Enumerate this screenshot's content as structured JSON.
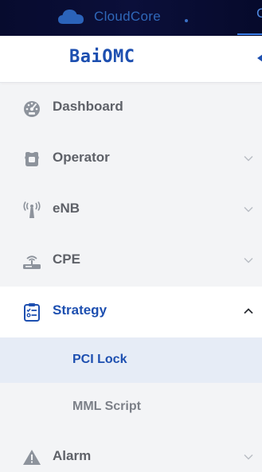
{
  "topbar": {
    "app_title": "CloudCore",
    "right_tab": "C",
    "cloud_icon": "cloud-icon"
  },
  "brand": {
    "title": "BaiOMC",
    "collapse_icon": "caret-left-icon"
  },
  "nav": {
    "items": [
      {
        "label": "Dashboard",
        "icon": "dashboard-gauge-icon",
        "has_chevron": false
      },
      {
        "label": "Operator",
        "icon": "operator-icon",
        "has_chevron": true,
        "chevron": "chevron-down-icon"
      },
      {
        "label": "eNB",
        "icon": "antenna-tower-icon",
        "has_chevron": true,
        "chevron": "chevron-down-icon"
      },
      {
        "label": "CPE",
        "icon": "router-icon",
        "has_chevron": true,
        "chevron": "chevron-down-icon"
      },
      {
        "label": "Strategy",
        "icon": "clipboard-checklist-icon",
        "has_chevron": true,
        "chevron": "chevron-up-icon",
        "expanded": true
      },
      {
        "label": "Alarm",
        "icon": "warning-triangle-icon",
        "has_chevron": true,
        "chevron": "chevron-down-icon"
      }
    ],
    "strategy_sub": [
      {
        "label": "PCI Lock",
        "active": true
      },
      {
        "label": "MML Script",
        "active": false
      }
    ]
  },
  "colors": {
    "accent": "#1d4fb0",
    "topbar_bg": "#070b2e",
    "muted_text": "#5e6168",
    "icon_gray": "#8d939c",
    "active_sub_bg": "#e6ecf6"
  }
}
